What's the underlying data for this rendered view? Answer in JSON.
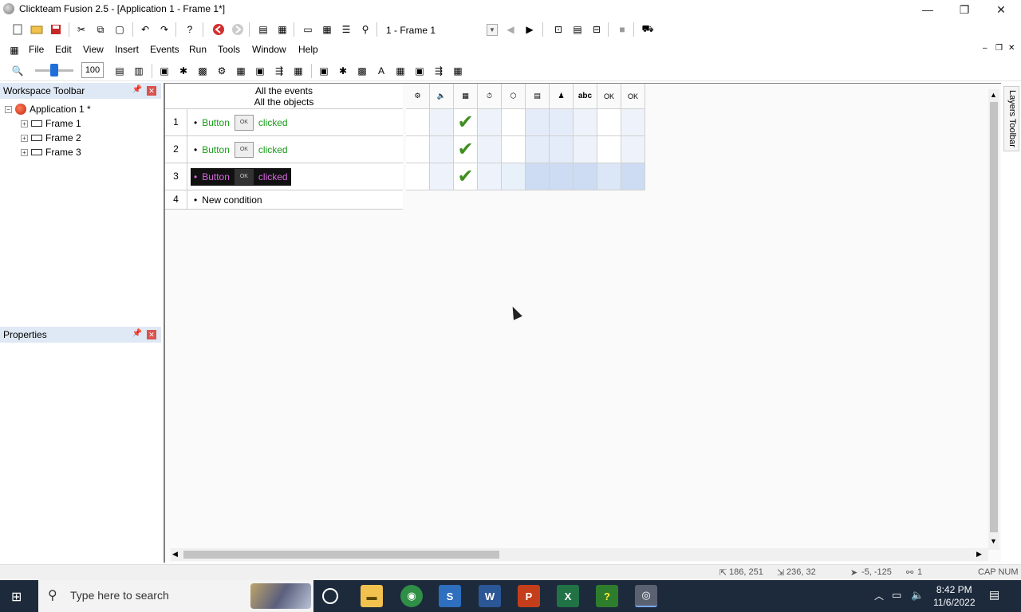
{
  "window": {
    "title": "Clickteam Fusion 2.5 - [Application 1 - Frame 1*]",
    "minimize": "—",
    "maximize": "❐",
    "close": "✕"
  },
  "toolbar": {
    "frame_selector": "1 - Frame 1",
    "zoom_value": "100"
  },
  "menu": {
    "items": [
      "File",
      "Edit",
      "View",
      "Insert",
      "Events",
      "Run",
      "Tools",
      "Window",
      "Help"
    ]
  },
  "workspace": {
    "title": "Workspace Toolbar",
    "application": "Application 1 *",
    "frames": [
      "Frame 1",
      "Frame 2",
      "Frame 3"
    ]
  },
  "properties": {
    "title": "Properties"
  },
  "events": {
    "header_line1": "All the events",
    "header_line2": "All the objects",
    "rows": [
      {
        "num": "1",
        "object": "Button",
        "icon": "OK",
        "action": "clicked"
      },
      {
        "num": "2",
        "object": "Button",
        "icon": "OK",
        "action": "clicked"
      },
      {
        "num": "3",
        "object": "Button",
        "icon": "OK",
        "action": "clicked"
      },
      {
        "num": "4",
        "new": "New condition"
      }
    ],
    "grid_headers": [
      "⚙",
      "🔈",
      "▦",
      "⏱",
      "⬡",
      "▤",
      "♟",
      "abc",
      "OK",
      "OK"
    ]
  },
  "layers_tab": "Layers Toolbar",
  "status": {
    "pos": "186, 251",
    "size": "236, 32",
    "offset": "-5, -125",
    "count": "1",
    "keys": "CAP NUM"
  },
  "taskbar": {
    "search_placeholder": "Type here to search",
    "time": "8:42 PM",
    "date": "11/6/2022"
  }
}
